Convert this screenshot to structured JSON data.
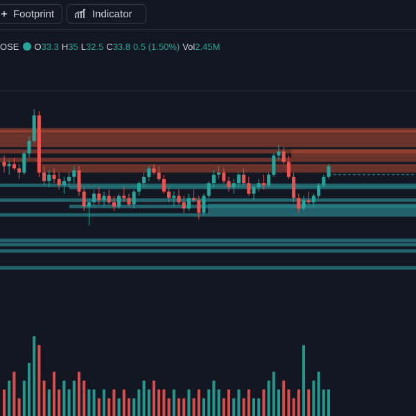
{
  "toolbar": {
    "footprint_label": "Footprint",
    "indicator_label": "Indicator"
  },
  "ohlc": {
    "prefix": "OSE",
    "open_label": "O",
    "open": "33.3",
    "high_label": "H",
    "high": "35",
    "low_label": "L",
    "low": "32.5",
    "close_label": "C",
    "close": "33.8",
    "change": "0.5 (1.50%)",
    "vol_label": "Vol",
    "vol": "2.45M"
  },
  "colors": {
    "background": "#131722",
    "up": "#26a69a",
    "down": "#ef5350",
    "resistance_zone": "#b34a33",
    "support_zone": "#2a7f86"
  },
  "icons": [
    "plus-icon",
    "indicator-bars-icon",
    "status-dot-icon"
  ],
  "chart_data": {
    "type": "candlestick",
    "candles": [
      [
        35.1,
        35.4,
        34.6,
        34.9
      ],
      [
        34.9,
        35.2,
        34.5,
        35.0
      ],
      [
        35.0,
        35.3,
        34.7,
        34.8
      ],
      [
        34.8,
        35.0,
        34.3,
        34.6
      ],
      [
        34.6,
        35.6,
        34.5,
        35.5
      ],
      [
        35.5,
        36.3,
        35.3,
        36.1
      ],
      [
        36.1,
        37.6,
        36.0,
        37.3
      ],
      [
        37.3,
        37.5,
        34.4,
        34.6
      ],
      [
        34.6,
        34.9,
        34.0,
        34.2
      ],
      [
        34.2,
        34.7,
        33.9,
        34.5
      ],
      [
        34.5,
        34.8,
        34.1,
        34.3
      ],
      [
        34.3,
        34.6,
        33.8,
        34.0
      ],
      [
        34.0,
        34.4,
        33.6,
        34.2
      ],
      [
        34.2,
        34.6,
        33.9,
        34.4
      ],
      [
        34.4,
        34.9,
        34.1,
        34.7
      ],
      [
        34.7,
        34.9,
        33.5,
        33.7
      ],
      [
        33.7,
        33.9,
        32.8,
        33.0
      ],
      [
        33.0,
        33.4,
        32.1,
        33.2
      ],
      [
        33.2,
        33.8,
        33.0,
        33.6
      ],
      [
        33.6,
        33.9,
        33.1,
        33.3
      ],
      [
        33.3,
        33.7,
        33.0,
        33.5
      ],
      [
        33.5,
        33.8,
        33.1,
        33.2
      ],
      [
        33.2,
        33.5,
        32.8,
        33.0
      ],
      [
        33.0,
        33.6,
        32.9,
        33.5
      ],
      [
        33.5,
        33.9,
        33.2,
        33.4
      ],
      [
        33.4,
        33.6,
        33.0,
        33.1
      ],
      [
        33.1,
        33.8,
        32.9,
        33.7
      ],
      [
        33.7,
        34.2,
        33.5,
        34.1
      ],
      [
        34.1,
        34.6,
        33.9,
        34.4
      ],
      [
        34.4,
        34.9,
        34.2,
        34.8
      ],
      [
        34.8,
        35.0,
        34.5,
        34.6
      ],
      [
        34.6,
        34.9,
        34.2,
        34.3
      ],
      [
        34.3,
        34.5,
        33.6,
        33.7
      ],
      [
        33.7,
        33.9,
        33.2,
        33.4
      ],
      [
        33.4,
        33.7,
        33.0,
        33.5
      ],
      [
        33.5,
        33.8,
        33.1,
        33.2
      ],
      [
        33.2,
        33.5,
        32.7,
        32.9
      ],
      [
        32.9,
        33.6,
        32.8,
        33.4
      ],
      [
        33.4,
        33.8,
        33.2,
        33.3
      ],
      [
        33.3,
        33.5,
        32.4,
        32.7
      ],
      [
        32.7,
        33.6,
        32.6,
        33.5
      ],
      [
        33.5,
        34.2,
        33.4,
        34.1
      ],
      [
        34.1,
        34.7,
        33.9,
        34.5
      ],
      [
        34.5,
        34.9,
        34.3,
        34.6
      ],
      [
        34.6,
        34.8,
        34.1,
        34.2
      ],
      [
        34.2,
        34.4,
        33.7,
        33.9
      ],
      [
        33.9,
        34.3,
        33.6,
        34.1
      ],
      [
        34.1,
        34.6,
        33.9,
        34.5
      ],
      [
        34.5,
        34.8,
        34.0,
        34.1
      ],
      [
        34.1,
        34.4,
        33.5,
        33.6
      ],
      [
        33.6,
        34.0,
        33.3,
        33.9
      ],
      [
        33.9,
        34.3,
        33.7,
        34.1
      ],
      [
        34.1,
        34.5,
        33.8,
        34.0
      ],
      [
        34.0,
        34.6,
        33.9,
        34.5
      ],
      [
        34.5,
        35.5,
        34.4,
        35.4
      ],
      [
        35.4,
        35.9,
        35.2,
        35.6
      ],
      [
        35.6,
        35.8,
        35.0,
        35.1
      ],
      [
        35.1,
        35.4,
        34.3,
        34.4
      ],
      [
        34.4,
        34.6,
        33.2,
        33.4
      ],
      [
        33.4,
        33.6,
        32.7,
        32.9
      ],
      [
        32.9,
        33.5,
        32.8,
        33.3
      ],
      [
        33.3,
        33.7,
        33.1,
        33.2
      ],
      [
        33.2,
        33.6,
        33.0,
        33.5
      ],
      [
        33.5,
        34.1,
        33.4,
        34.0
      ],
      [
        34.0,
        34.5,
        33.9,
        34.4
      ],
      [
        34.4,
        35.0,
        34.3,
        34.9
      ]
    ],
    "volume": [
      3,
      4,
      5,
      2,
      4,
      6,
      9,
      8,
      4,
      3,
      5,
      3,
      4,
      3,
      4,
      5,
      4,
      3,
      3,
      2,
      3,
      2,
      3,
      2,
      3,
      2,
      2,
      3,
      4,
      3,
      4,
      3,
      3,
      2,
      3,
      2,
      2,
      3,
      2,
      3,
      2,
      3,
      4,
      3,
      2,
      3,
      2,
      3,
      2,
      3,
      2,
      2,
      3,
      4,
      5,
      3,
      4,
      3,
      2,
      3,
      8,
      3,
      4,
      5,
      3,
      3
    ],
    "resistance_levels": [
      36.6,
      36.5,
      36.3,
      36.1,
      35.9,
      35.6,
      35.2,
      34.9,
      34.7,
      35.6,
      35.4
    ],
    "support_levels": [
      34.0,
      33.9,
      33.3,
      33.0,
      32.6,
      31.4,
      31.2,
      30.9,
      30.1
    ]
  }
}
